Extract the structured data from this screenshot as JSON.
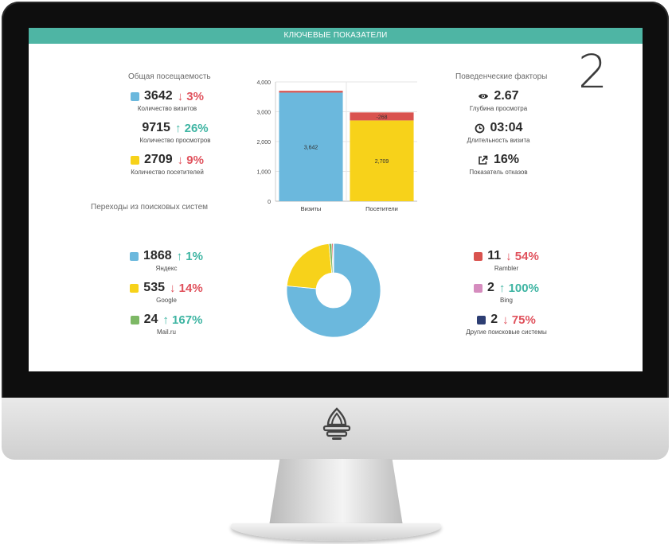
{
  "header": {
    "title": "КЛЮЧЕВЫЕ ПОКАЗАТЕЛИ",
    "page_number": "2"
  },
  "attendance": {
    "title": "Общая посещаемость",
    "items": [
      {
        "value": "3642",
        "change": "↓ 3%",
        "direction": "down",
        "label": "Количество визитов",
        "color": "#6bb8dd"
      },
      {
        "value": "9715",
        "change": "↑ 26%",
        "direction": "up",
        "label": "Количество просмотров",
        "color": ""
      },
      {
        "value": "2709",
        "change": "↓ 9%",
        "direction": "down",
        "label": "Количество посетителей",
        "color": "#f7d21a"
      }
    ]
  },
  "behavior": {
    "title": "Поведенческие факторы",
    "items": [
      {
        "icon": "eye-icon",
        "value": "2.67",
        "label": "Глубина просмотра"
      },
      {
        "icon": "clock-icon",
        "value": "03:04",
        "label": "Длительность визита"
      },
      {
        "icon": "external-link-icon",
        "value": "16%",
        "label": "Показатель отказов"
      }
    ]
  },
  "search": {
    "title": "Переходы из поисковых систем",
    "left_items": [
      {
        "value": "1868",
        "change": "↑ 1%",
        "direction": "up",
        "label": "Яндекс",
        "color": "#6bb8dd"
      },
      {
        "value": "535",
        "change": "↓ 14%",
        "direction": "down",
        "label": "Google",
        "color": "#f7d21a"
      },
      {
        "value": "24",
        "change": "↑ 167%",
        "direction": "up",
        "label": "Mail.ru",
        "color": "#7db865"
      }
    ],
    "right_items": [
      {
        "value": "11",
        "change": "↓ 54%",
        "direction": "down",
        "label": "Rambler",
        "color": "#d9534f"
      },
      {
        "value": "2",
        "change": "↑ 100%",
        "direction": "up",
        "label": "Bing",
        "color": "#d58cbe"
      },
      {
        "value": "2",
        "change": "↓ 75%",
        "direction": "down",
        "label": "Другие поисковые системы",
        "color": "#2d3e73"
      }
    ]
  },
  "chart_data": [
    {
      "type": "bar",
      "stacked": true,
      "categories": [
        "Визиты",
        "Посетители"
      ],
      "series": [
        {
          "values": [
            3642,
            2709
          ],
          "labels": [
            "3,642",
            "2,709"
          ],
          "colors": [
            "#6bb8dd",
            "#f7d21a"
          ]
        },
        {
          "values": [
            60,
            268
          ],
          "labels": [
            "",
            "-268"
          ],
          "color": "#d9534f"
        }
      ],
      "yticks": [
        "0",
        "1,000",
        "2,000",
        "3,000",
        "4,000"
      ],
      "ylim": [
        0,
        4000
      ],
      "grid": true
    },
    {
      "type": "pie",
      "donut": true,
      "slices": [
        {
          "value": 1868,
          "color": "#6bb8dd"
        },
        {
          "value": 535,
          "color": "#f7d21a"
        },
        {
          "value": 24,
          "color": "#7db865"
        },
        {
          "value": 11,
          "color": "#d9534f"
        },
        {
          "value": 2,
          "color": "#d58cbe"
        },
        {
          "value": 2,
          "color": "#2d3e73"
        }
      ]
    }
  ]
}
